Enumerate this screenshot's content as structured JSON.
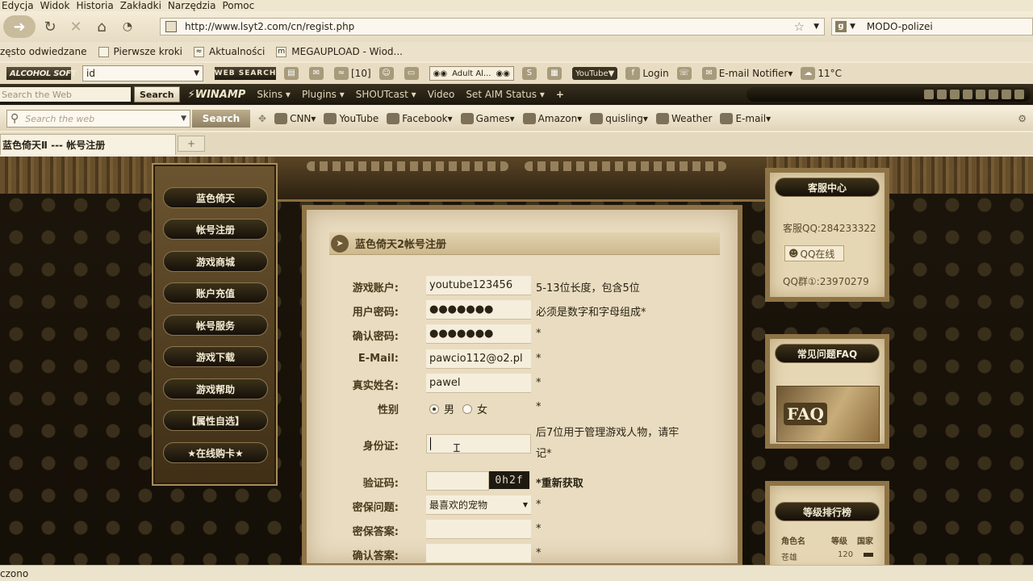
{
  "menu": [
    "Edycja",
    "Widok",
    "Historia",
    "Zakładki",
    "Narzędzia",
    "Pomoc"
  ],
  "url": "http://www.lsyt2.com/cn/regist.php",
  "search_engine_text": "MODO-polizei",
  "bookmarks": [
    "zęsto odwiedzane",
    "Pierwsze kroki",
    "Aktualności",
    "MEGAUPLOAD - Wiod..."
  ],
  "toolbar1": {
    "alcohol": "ALCOHOL SOFT",
    "id_field": "id",
    "web_search": "WEB SEARCH",
    "count": "[10]",
    "adult": "Adult Al...",
    "youtube": "YouTube",
    "login": "Login",
    "email_notifier": "E-mail Notifier",
    "temperature": "11°C"
  },
  "toolbar2": {
    "search_placeholder": "Search the Web",
    "search_btn": "Search",
    "winamp": "WINAMP",
    "items": [
      "Skins",
      "Plugins",
      "SHOUTcast",
      "Video",
      "Set AIM Status"
    ]
  },
  "toolbar3": {
    "search_placeholder": "Search the web",
    "search_btn": "Search",
    "items": [
      "CNN",
      "YouTube",
      "Facebook",
      "Games",
      "Amazon",
      "quisling",
      "Weather",
      "E-mail"
    ]
  },
  "tab": {
    "title": "蓝色倚天Ⅱ --- 帐号注册",
    "new_tab": "+"
  },
  "left_menu": [
    "蓝色倚天",
    "帐号注册",
    "游戏商城",
    "账户充值",
    "帐号服务",
    "游戏下载",
    "游戏帮助",
    "【属性自选】",
    "★在线购卡★"
  ],
  "form": {
    "title": "蓝色倚天2帐号注册",
    "rows": [
      {
        "label": "游戏账户:",
        "value": "youtube123456",
        "hint": "5-13位长度，包含5位"
      },
      {
        "label": "用户密码:",
        "value": "●●●●●●●",
        "hint": "必须是数字和字母组成*"
      },
      {
        "label": "确认密码:",
        "value": "●●●●●●●",
        "hint": "*"
      },
      {
        "label": "E-Mail:",
        "value": "pawcio112@o2.pl",
        "hint": "*"
      },
      {
        "label": "真实姓名:",
        "value": "pawel",
        "hint": "*"
      }
    ],
    "gender_label": "性别",
    "gender_male": "男",
    "gender_female": "女",
    "gender_hint": "*",
    "id_label": "身份证:",
    "id_hint_line1": "后7位用于管理游戏人物，请牢",
    "id_hint_line2": "记*",
    "captcha_label": "验证码:",
    "captcha_image": "0h2f",
    "captcha_refresh": "*重新获取",
    "question_label": "密保问题:",
    "question_value": "最喜欢的宠物",
    "question_hint": "*",
    "answer_label": "密保答案:",
    "answer_hint": "*",
    "confirm_label": "确认答案:",
    "confirm_hint": "*"
  },
  "service": {
    "title": "客服中心",
    "qq": "客服QQ:284233322",
    "qq_button": "QQ在线",
    "group": "QQ群①:23970279"
  },
  "faq": {
    "title": "常见问题FAQ",
    "image_text": "FAQ"
  },
  "ranking": {
    "title": "等级排行榜",
    "headers": [
      "角色名",
      "等级",
      "国家"
    ],
    "row": [
      "苍雄",
      "120",
      ""
    ]
  },
  "status": "czono"
}
